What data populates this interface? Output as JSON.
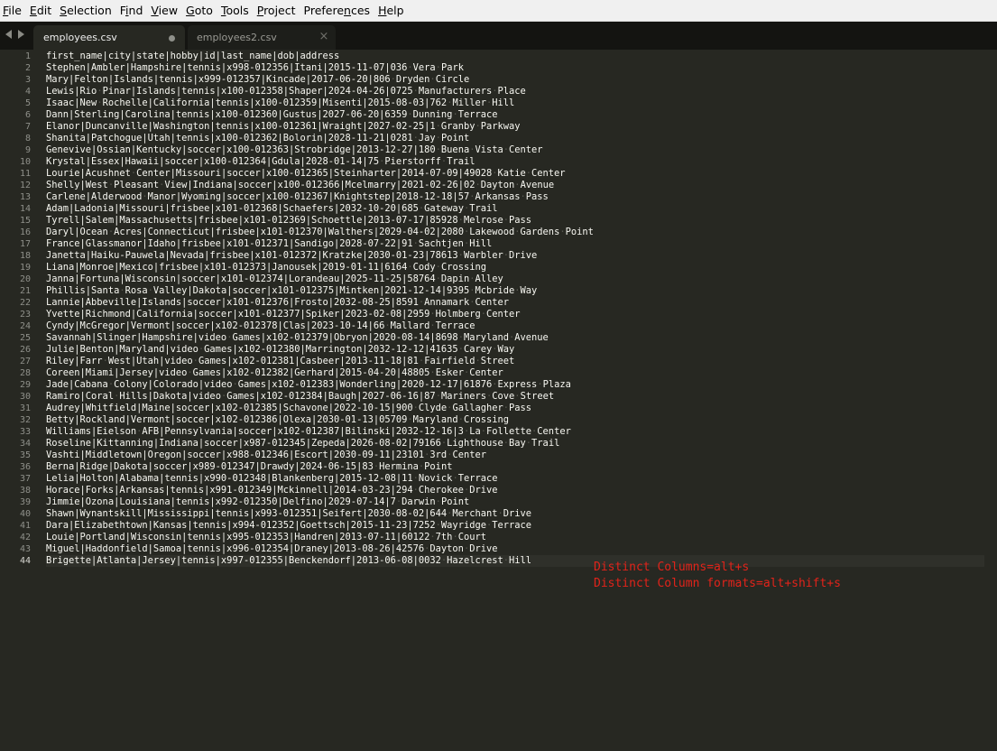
{
  "menu": [
    "File",
    "Edit",
    "Selection",
    "Find",
    "View",
    "Goto",
    "Tools",
    "Project",
    "Preferences",
    "Help"
  ],
  "menu_mnemonics": [
    "F",
    "E",
    "S",
    "i",
    "V",
    "G",
    "T",
    "P",
    "n",
    "H"
  ],
  "tabs": [
    {
      "label": "employees.csv",
      "active": true,
      "dirty": true
    },
    {
      "label": "employees2.csv",
      "active": false,
      "dirty": false
    }
  ],
  "close_glyph": "×",
  "current_line": 44,
  "lines": [
    "first_name|city|state|hobby|id|last_name|dob|address",
    "Stephen|Ambler|Hampshire|tennis|x998-012356|Itani|2015-11-07|036 Vera Park",
    "Mary|Felton|Islands|tennis|x999-012357|Kincade|2017-06-20|806 Dryden Circle",
    "Lewis|Rio Pinar|Islands|tennis|x100-012358|Shaper|2024-04-26|0725 Manufacturers Place",
    "Isaac|New Rochelle|California|tennis|x100-012359|Misenti|2015-08-03|762 Miller Hill",
    "Dann|Sterling|Carolina|tennis|x100-012360|Gustus|2027-06-20|6359 Dunning Terrace",
    "Elanor|Duncanville|Washington|tennis|x100-012361|Wraight|2027-02-25|1 Granby Parkway",
    "Shanita|Patchogue|Utah|tennis|x100-012362|Bolorin|2028-11-21|0281 Jay Point",
    "Genevive|Ossian|Kentucky|soccer|x100-012363|Strobridge|2013-12-27|180 Buena Vista Center",
    "Krystal|Essex|Hawaii|soccer|x100-012364|Gdula|2028-01-14|75 Pierstorff Trail",
    "Lourie|Acushnet Center|Missouri|soccer|x100-012365|Steinharter|2014-07-09|49028 Katie Center",
    "Shelly|West Pleasant View|Indiana|soccer|x100-012366|Mcelmarry|2021-02-26|02 Dayton Avenue",
    "Carlene|Alderwood Manor|Wyoming|soccer|x100-012367|Knightstep|2018-12-18|57 Arkansas Pass",
    "Adam|Ladonia|Missouri|frisbee|x101-012368|Schaefers|2032-10-20|685 Gateway Trail",
    "Tyrell|Salem|Massachusetts|frisbee|x101-012369|Schoettle|2013-07-17|85928 Melrose Pass",
    "Daryl|Ocean Acres|Connecticut|frisbee|x101-012370|Walthers|2029-04-02|2080 Lakewood Gardens Point",
    "France|Glassmanor|Idaho|frisbee|x101-012371|Sandigo|2028-07-22|91 Sachtjen Hill",
    "Janetta|Haiku-Pauwela|Nevada|frisbee|x101-012372|Kratzke|2030-01-23|78613 Warbler Drive",
    "Liana|Monroe|Mexico|frisbee|x101-012373|Janousek|2019-01-11|6164 Cody Crossing",
    "Janna|Fortuna|Wisconsin|soccer|x101-012374|Lorandeau|2025-11-25|58764 Dapin Alley",
    "Phillis|Santa Rosa Valley|Dakota|soccer|x101-012375|Mintken|2021-12-14|9395 Mcbride Way",
    "Lannie|Abbeville|Islands|soccer|x101-012376|Frosto|2032-08-25|8591 Annamark Center",
    "Yvette|Richmond|California|soccer|x101-012377|Spiker|2023-02-08|2959 Holmberg Center",
    "Cyndy|McGregor|Vermont|soccer|x102-012378|Clas|2023-10-14|66 Mallard Terrace",
    "Savannah|Slinger|Hampshire|video Games|x102-012379|Obryon|2020-08-14|8698 Maryland Avenue",
    "Julie|Benton|Maryland|video Games|x102-012380|Marrington|2032-12-12|41635 Carey Way",
    "Riley|Farr West|Utah|video Games|x102-012381|Casbeer|2013-11-18|81 Fairfield Street",
    "Coreen|Miami|Jersey|video Games|x102-012382|Gerhard|2015-04-20|48805 Esker Center",
    "Jade|Cabana Colony|Colorado|video Games|x102-012383|Wonderling|2020-12-17|61876 Express Plaza",
    "Ramiro|Coral Hills|Dakota|video Games|x102-012384|Baugh|2027-06-16|87 Mariners Cove Street",
    "Audrey|Whitfield|Maine|soccer|x102-012385|Schavone|2022-10-15|900 Clyde Gallagher Pass",
    "Betty|Rockland|Vermont|soccer|x102-012386|Olexa|2030-01-13|05709 Maryland Crossing",
    "Williams|Eielson AFB|Pennsylvania|soccer|x102-012387|Bilinski|2032-12-16|3 La Follette Center",
    "Roseline|Kittanning|Indiana|soccer|x987-012345|Zepeda|2026-08-02|79166 Lighthouse Bay Trail",
    "Vashti|Middletown|Oregon|soccer|x988-012346|Escort|2030-09-11|23101 3rd Center",
    "Berna|Ridge|Dakota|soccer|x989-012347|Drawdy|2024-06-15|83 Hermina Point",
    "Lelia|Holton|Alabama|tennis|x990-012348|Blankenberg|2015-12-08|11 Novick Terrace",
    "Horace|Forks|Arkansas|tennis|x991-012349|Mckinnell|2014-03-23|294 Cherokee Drive",
    "Jimmie|Ozona|Louisiana|tennis|x992-012350|Delfino|2029-07-14|7 Darwin Point",
    "Shawn|Wynantskill|Mississippi|tennis|x993-012351|Seifert|2030-08-02|644 Merchant Drive",
    "Dara|Elizabethtown|Kansas|tennis|x994-012352|Goettsch|2015-11-23|7252 Wayridge Terrace",
    "Louie|Portland|Wisconsin|tennis|x995-012353|Handren|2013-07-11|60122 7th Court",
    "Miguel|Haddonfield|Samoa|tennis|x996-012354|Draney|2013-08-26|42576 Dayton Drive",
    "Brigette|Atlanta|Jersey|tennis|x997-012355|Benckendorf|2013-06-08|0032 Hazelcrest Hill"
  ],
  "annotations": [
    "Distinct Columns=alt+s",
    "Distinct Column formats=alt+shift+s"
  ],
  "colors": {
    "editor_bg": "#272822",
    "text": "#f8f8f2",
    "gutter_text": "#8f908a",
    "whitespace_dot": "#575850",
    "annotation": "#e2231a",
    "menubar_bg": "#f0f0f0",
    "tabbar_bg": "#141411"
  }
}
